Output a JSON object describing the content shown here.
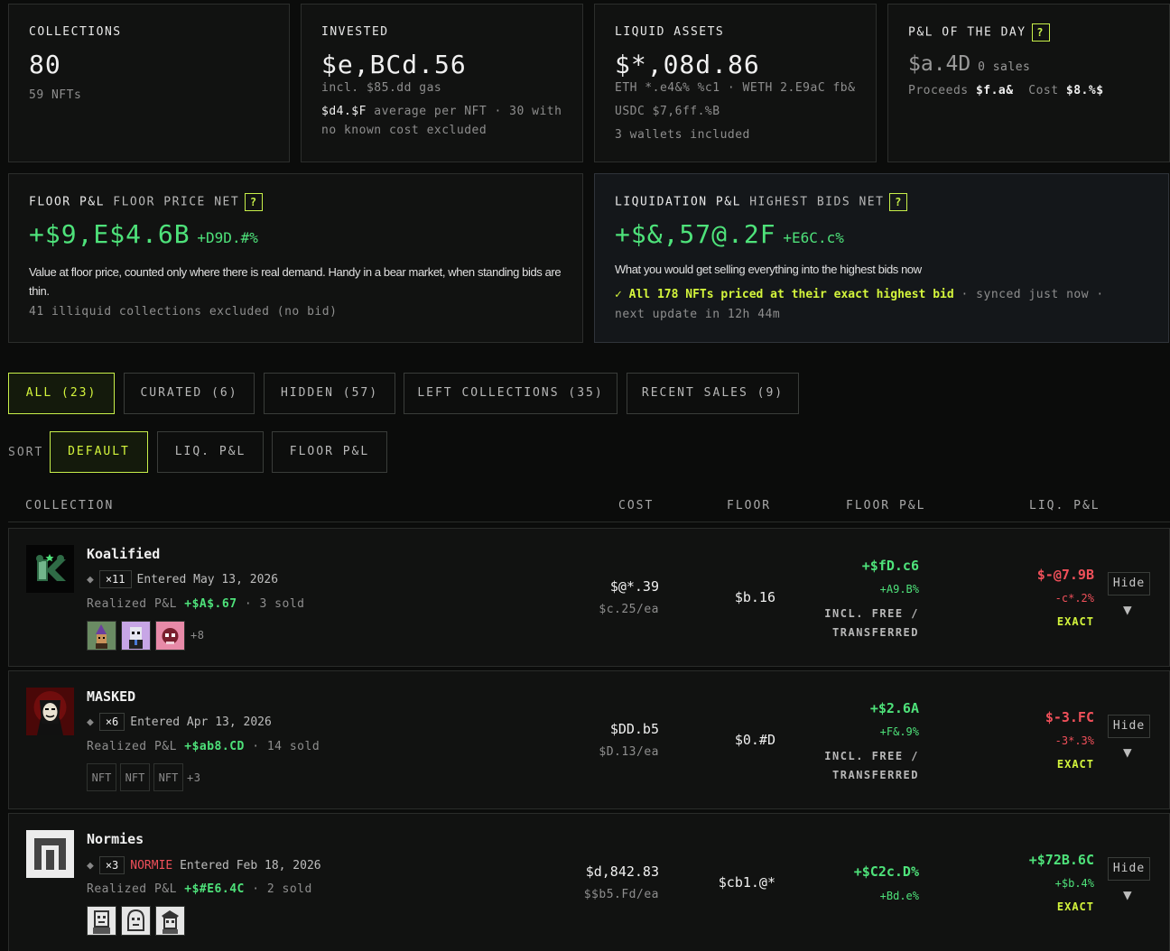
{
  "stats": {
    "collections": {
      "label": "COLLECTIONS",
      "value": "80",
      "sub": "59 NFTs"
    },
    "invested": {
      "label": "INVESTED",
      "value": "$e,BCd.56",
      "gas": "incl. $85.dd gas",
      "avg_value": "$d4.$F",
      "avg_text": "average per NFT · 30 with",
      "excluded": "no known cost excluded"
    },
    "liquid": {
      "label": "LIQUID ASSETS",
      "value": "$*,08d.86",
      "line1": "ETH *.e4&% %c1 · WETH 2.E9aC fb&",
      "line2": "USDC $7,6ff.%B",
      "line3": "3 wallets included"
    },
    "pnl_day": {
      "label": "P&L OF THE DAY",
      "badge": "?",
      "value": "$a.4D",
      "sales": "0 sales",
      "proceeds_label": "Proceeds",
      "proceeds_value": "$f.a&",
      "cost_label": "Cost",
      "cost_value": "$8.%$"
    }
  },
  "floor_pnl": {
    "label": "FLOOR P&L",
    "label_muted": "FLOOR PRICE NET",
    "badge": "?",
    "value": "+$9,E$4.6B",
    "delta": "+D9D.#%",
    "desc": "Value at floor price, counted only where there is real demand. Handy in a bear market, when standing bids are thin.",
    "note": "41 illiquid collections excluded (no bid)"
  },
  "liq_pnl": {
    "label": "LIQUIDATION P&L",
    "label_muted": "HIGHEST BIDS NET",
    "badge": "?",
    "value": "+$&,57@.2F",
    "delta": "+E6C.c%",
    "desc": "What you would get selling everything into the highest bids now",
    "check": "✓ All 178 NFTs priced at their exact highest bid",
    "synced": "· synced just now ·",
    "next": "next update in 12h 44m"
  },
  "tabs": [
    "ALL (23)",
    "CURATED (6)",
    "HIDDEN (57)",
    "LEFT COLLECTIONS (35)",
    "RECENT SALES (9)"
  ],
  "sort": {
    "label": "SORT",
    "options": [
      "DEFAULT",
      "LIQ. P&L",
      "FLOOR P&L"
    ]
  },
  "columns": {
    "collection": "COLLECTION",
    "cost": "COST",
    "floor": "FLOOR",
    "floor_pnl": "FLOOR P&L",
    "liq_pnl": "LIQ. P&L"
  },
  "rows": [
    {
      "name": "Koalified",
      "qty": "×11",
      "tag": "",
      "entered": "Entered May 13, 2026",
      "realized_label": "Realized P&L",
      "realized": "+$A$.67",
      "sold": "· 3 sold",
      "more": "+8",
      "cost": "$@*.39",
      "cost_ea": "$c.25/ea",
      "floor": "$b.16",
      "floor_pnl": "+$fD.c6",
      "floor_pct": "+A9.B%",
      "floor_note1": "INCL. FREE /",
      "floor_note2": "TRANSFERRED",
      "liq": "$-@7.9B",
      "liq_pct": "-c*.2%",
      "exact": "EXACT",
      "hide": "Hide"
    },
    {
      "name": "MASKED",
      "qty": "×6",
      "tag": "",
      "entered": "Entered Apr 13, 2026",
      "realized_label": "Realized P&L",
      "realized": "+$ab8.CD",
      "sold": "· 14 sold",
      "nft_labels": [
        "NFT",
        "NFT",
        "NFT"
      ],
      "more": "+3",
      "cost": "$DD.b5",
      "cost_ea": "$D.13/ea",
      "floor": "$0.#D",
      "floor_pnl": "+$2.6A",
      "floor_pct": "+F&.9%",
      "floor_note1": "INCL. FREE /",
      "floor_note2": "TRANSFERRED",
      "liq": "$-3.FC",
      "liq_pct": "-3*.3%",
      "exact": "EXACT",
      "hide": "Hide"
    },
    {
      "name": "Normies",
      "qty": "×3",
      "tag": "NORMIE",
      "entered": "Entered Feb 18, 2026",
      "realized_label": "Realized P&L",
      "realized": "+$#E6.4C",
      "sold": "· 2 sold",
      "cost": "$d,842.83",
      "cost_ea": "$$b5.Fd/ea",
      "floor": "$cb1.@*",
      "floor_pnl": "+$C2c.D%",
      "floor_pct": "+Bd.e%",
      "liq": "+$72B.6C",
      "liq_pct": "+$b.4%",
      "exact": "EXACT",
      "hide": "Hide"
    }
  ],
  "colors": {
    "accent": "#c8f04a",
    "positive": "#4ee27a",
    "negative": "#f0505a",
    "bg": "#0b0c0b"
  }
}
